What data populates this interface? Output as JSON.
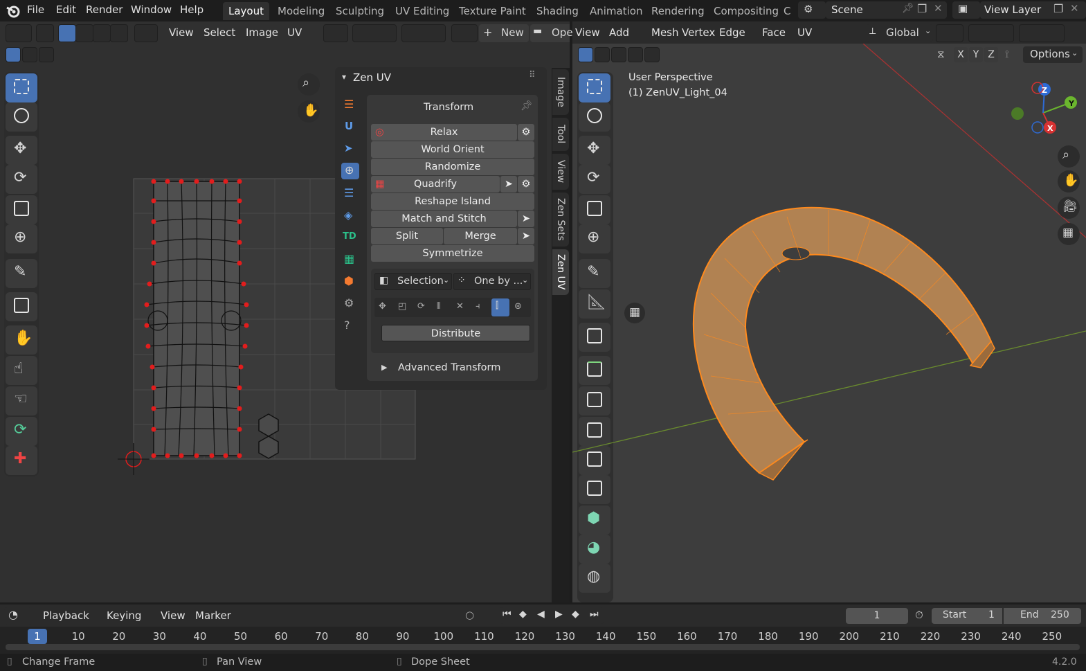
{
  "menubar": {
    "items": [
      "File",
      "Edit",
      "Render",
      "Window",
      "Help"
    ]
  },
  "workspaces": [
    "Layout",
    "Modeling",
    "Sculpting",
    "UV Editing",
    "Texture Paint",
    "Shading",
    "Animation",
    "Rendering",
    "Compositing",
    "C"
  ],
  "scene": {
    "label": "Scene",
    "view_layer": "View Layer"
  },
  "uv_header": {
    "menus": [
      "View",
      "Select",
      "Image",
      "UV"
    ],
    "new_label": "New",
    "open_label": "Ope"
  },
  "vp_header": {
    "menus": [
      "View",
      "Add",
      "Mesh",
      "Vertex",
      "Edge",
      "Face",
      "UV"
    ],
    "orientation": "Global",
    "axes": [
      "X",
      "Y",
      "Z"
    ],
    "options": "Options"
  },
  "viewport": {
    "perspective": "User Perspective",
    "object": "(1) ZenUV_Light_04"
  },
  "zen": {
    "title": "Zen UV",
    "transform_title": "Transform",
    "buttons": {
      "relax": "Relax",
      "world_orient": "World Orient",
      "randomize": "Randomize",
      "quadrify": "Quadrify",
      "reshape": "Reshape Island",
      "match": "Match and Stitch",
      "split": "Split",
      "merge": "Merge",
      "symmetrize": "Symmetrize"
    },
    "selection": "Selection",
    "one_by": "One by ...",
    "distribute": "Distribute",
    "advanced": "Advanced Transform"
  },
  "npanel_tabs": [
    "Image",
    "Tool",
    "View",
    "Zen Sets",
    "Zen UV"
  ],
  "timeline": {
    "menus": [
      "Playback",
      "Keying",
      "View",
      "Marker"
    ],
    "current": "1",
    "start_label": "Start",
    "start": "1",
    "end_label": "End",
    "end": "250",
    "ticks": [
      "1",
      "10",
      "20",
      "30",
      "40",
      "50",
      "60",
      "70",
      "80",
      "90",
      "100",
      "110",
      "120",
      "130",
      "140",
      "150",
      "160",
      "170",
      "180",
      "190",
      "200",
      "210",
      "220",
      "230",
      "240",
      "250"
    ]
  },
  "statusbar": {
    "items": [
      "Change Frame",
      "Pan View",
      "Dope Sheet"
    ],
    "version": "4.2.0"
  }
}
